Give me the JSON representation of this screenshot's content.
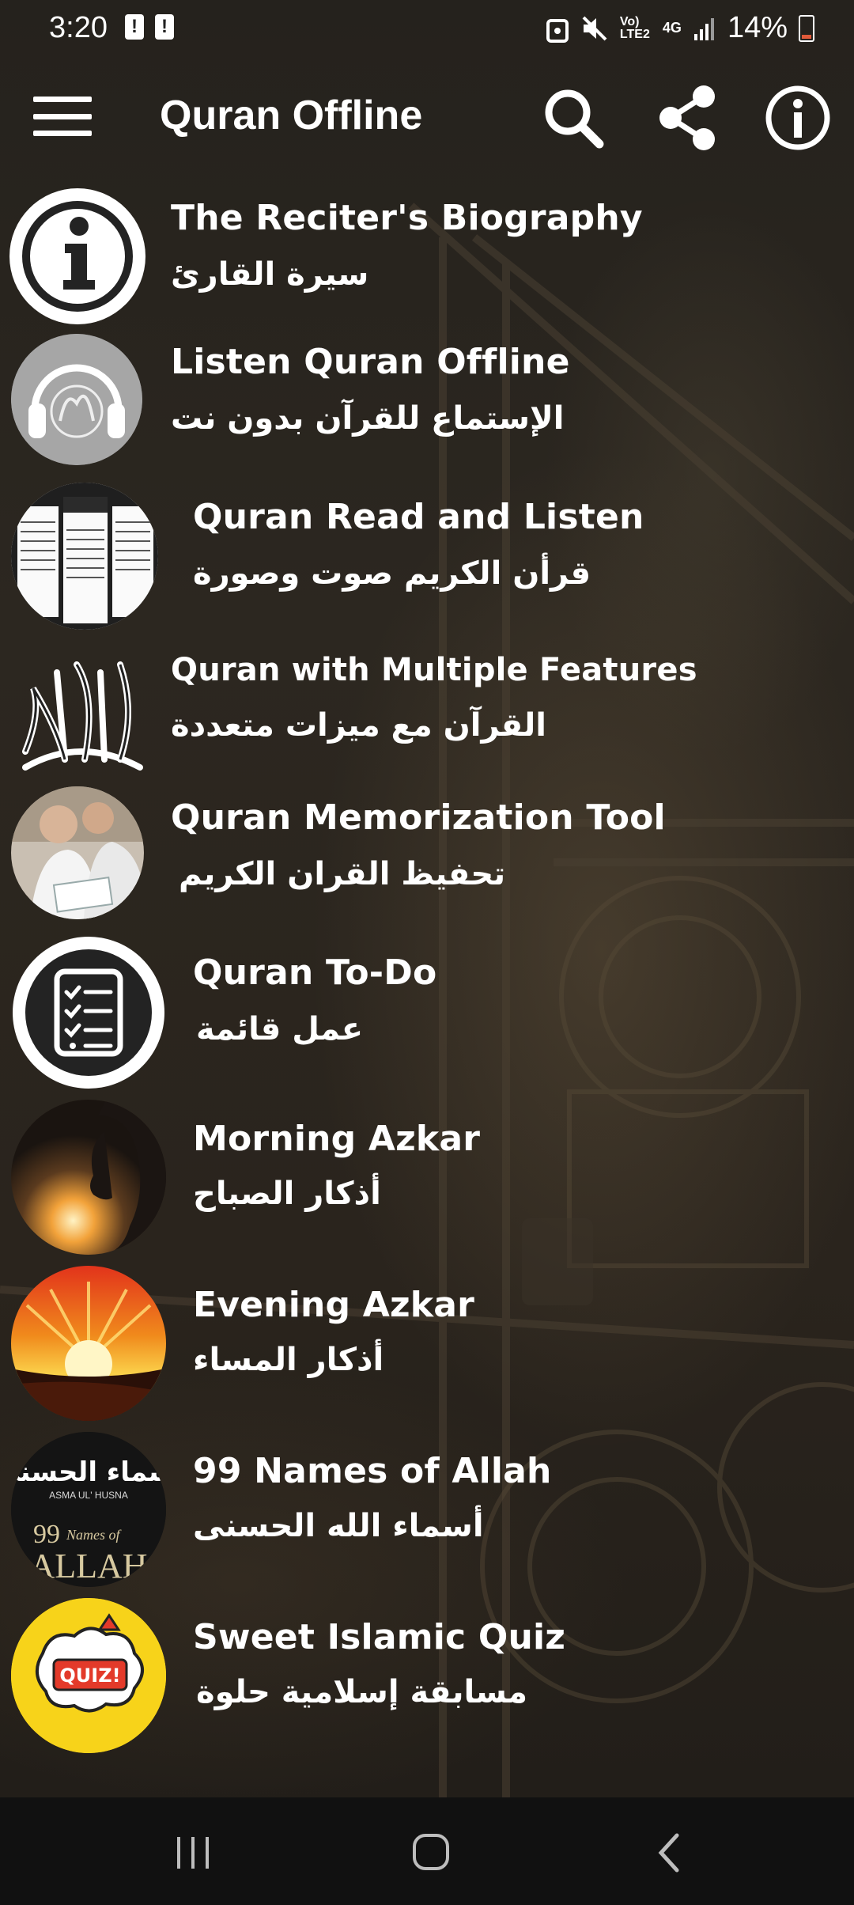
{
  "status_bar": {
    "time": "3:20",
    "network": "Vo) LTE2",
    "network_type": "4G",
    "battery": "14%"
  },
  "app_bar": {
    "title": "Quran Offline",
    "icons": [
      "menu-icon",
      "search-icon",
      "share-icon",
      "info-icon"
    ]
  },
  "items": [
    {
      "title": "The Reciter's Biography",
      "arabic": "سيرة القارئ",
      "icon": "info-circle-icon"
    },
    {
      "title": "Listen Quran Offline",
      "arabic": "الإستماع للقرآن بدون نت",
      "icon": "headphones-quran-icon"
    },
    {
      "title": "Quran Read and Listen",
      "arabic": "قرأن الكريم صوت وصورة",
      "icon": "quran-pages-icon"
    },
    {
      "title": "Quran with Multiple Features",
      "arabic": "القرآن مع ميزات متعددة",
      "icon": "quran-calligraphy-icon"
    },
    {
      "title": "Quran Memorization Tool",
      "arabic": "تحفيظ القران الكريم",
      "icon": "children-reading-icon"
    },
    {
      "title": "Quran To-Do",
      "arabic": "عمل قائمة",
      "icon": "checklist-icon"
    },
    {
      "title": "Morning Azkar",
      "arabic": "أذكار الصباح",
      "icon": "praying-silhouette-icon"
    },
    {
      "title": "Evening Azkar",
      "arabic": "أذكار المساء",
      "icon": "sunset-icon"
    },
    {
      "title": "99 Names of Allah",
      "arabic": "أسماء الله الحسنى",
      "icon": "asma-ul-husna-icon"
    },
    {
      "title": "Sweet Islamic Quiz",
      "arabic": "مسابقة إسلامية حلوة",
      "icon": "quiz-icon"
    }
  ],
  "asma_thumb": {
    "arabic": "اسماء الحسنى",
    "subtitle": "ASMA UL' HUSNA",
    "number": "99",
    "names_of": "Names of",
    "allah": "ALLAH"
  },
  "quiz_thumb": {
    "label": "QUIZ!"
  },
  "nav_bar": {
    "icons": [
      "recents-icon",
      "home-icon",
      "back-icon"
    ]
  },
  "colors": {
    "background": "#2a241d",
    "nav_bar": "#111111",
    "text": "#ffffff",
    "sunset_orange": "#f08a1c",
    "quiz_yellow": "#f7d31a"
  }
}
